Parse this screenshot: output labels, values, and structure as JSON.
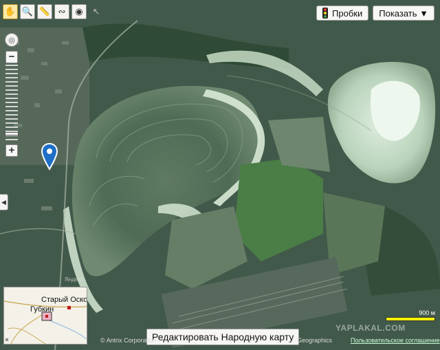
{
  "toolbar": {
    "tools": [
      {
        "name": "hand-tool",
        "icon": "✋",
        "active": true
      },
      {
        "name": "magnifier-tool",
        "icon": "🔍",
        "active": false
      },
      {
        "name": "ruler-tool",
        "icon": "📏",
        "active": false
      },
      {
        "name": "route-tool",
        "icon": "∾",
        "active": false
      },
      {
        "name": "balloon-tool",
        "icon": "◉",
        "active": false
      },
      {
        "name": "cursor-tool",
        "icon": "↖",
        "active": false
      }
    ]
  },
  "top_buttons": {
    "traffic_label": "Пробки",
    "show_label": "Показать ▼"
  },
  "zoom": {
    "plus": "+",
    "minus": "−",
    "compass": "◎"
  },
  "side_toggle": "◀",
  "minimap": {
    "label_1": "Старый Оскол",
    "label_2": "Губкин"
  },
  "edit_button": "Редактировать Народную карту",
  "copyright": {
    "left": "© Antrix Corporation",
    "right": "Geographics",
    "terms": "Пользовательское соглашение"
  },
  "watermark": "YAPLAKAL.COM",
  "scale": {
    "value": "900 м"
  },
  "road_labels": [
    "Яндекс"
  ],
  "colors": {
    "marker": "#1f6fc7",
    "scale_bar": "#fff200"
  }
}
